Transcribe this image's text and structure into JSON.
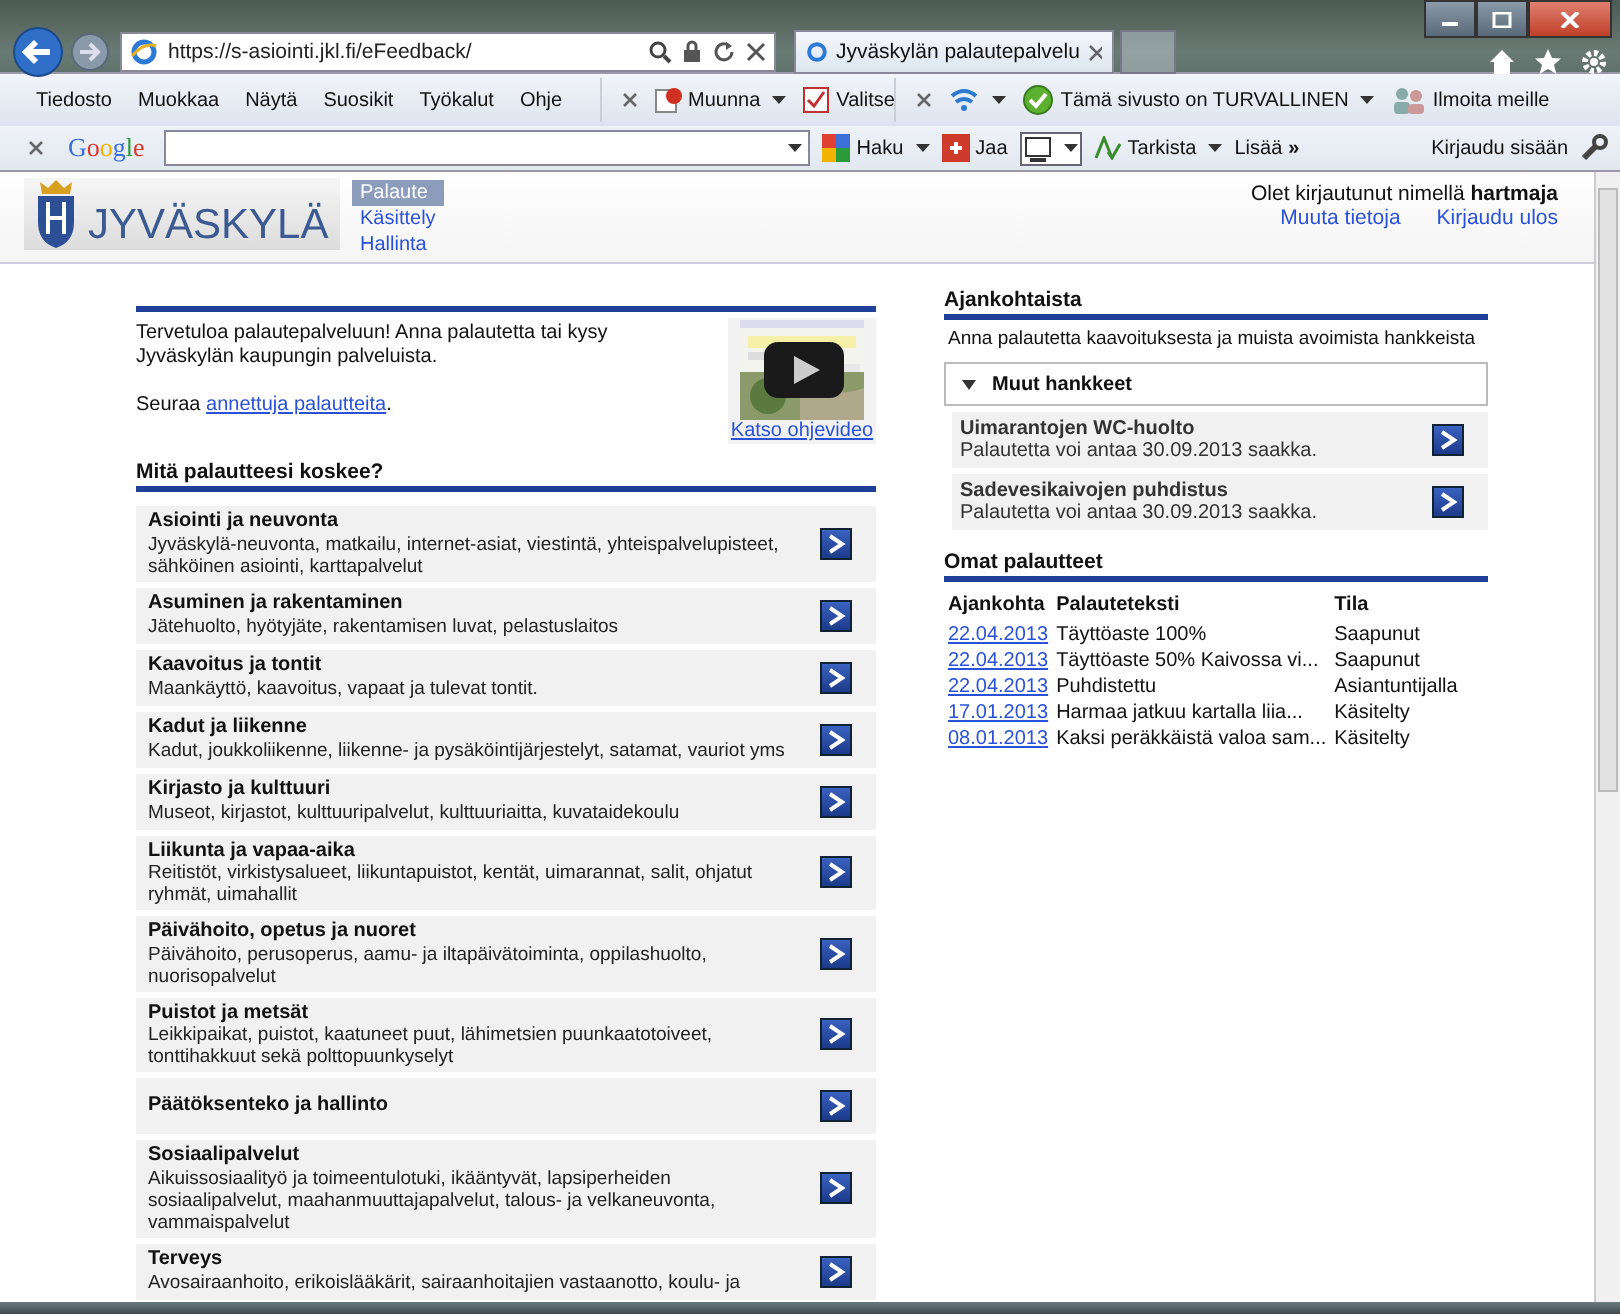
{
  "browser": {
    "address": "https://s-asiointi.jkl.fi/eFeedback/",
    "tab_title": "Jyväskylän palautepalvelu",
    "menu": [
      "Tiedosto",
      "Muokkaa",
      "Näytä",
      "Suosikit",
      "Työkalut",
      "Ohje"
    ],
    "toolbar": [
      {
        "kind": "convert",
        "label": "Muunna"
      },
      {
        "kind": "select",
        "label": "Valitse"
      }
    ],
    "safety": {
      "status": "Tämä sivusto on TURVALLINEN",
      "report": "Ilmoita meille"
    },
    "google": {
      "logo": "Google",
      "search": "Haku",
      "share": "Jaa",
      "check": "Tarkista",
      "more": "Lisää",
      "more_glyph": "»",
      "signin": "Kirjaudu sisään"
    }
  },
  "site": {
    "logo": "JYVÄSKYLÄ",
    "nav": [
      {
        "label": "Palaute",
        "selected": true
      },
      {
        "label": "Käsittely",
        "selected": false
      },
      {
        "label": "Hallinta",
        "selected": false
      }
    ],
    "login": "Olet kirjautunut nimellä **hartmaja**",
    "user_links": [
      "Muuta tietoja",
      "Kirjaudu ulos"
    ]
  },
  "intro": {
    "text": "Tervetuloa palautepalveluun! Anna palautetta tai kysy Jyväskylän kaupungin palveluista.",
    "follow": "Seuraa",
    "follow_link": "annettuja palautteita",
    "follow_end": ".",
    "video_link": "Katso ohjevideo"
  },
  "categories_title": "Mitä palautteesi koskee?",
  "categories": [
    {
      "title": "Asiointi ja neuvonta",
      "description": "Jyväskylä-neuvonta, matkailu, internet-asiat, viestintä, yhteispalvelupisteet, sähköinen asiointi, karttapalvelut"
    },
    {
      "title": "Asuminen ja rakentaminen",
      "description": "Jätehuolto, hyötyjäte, rakentamisen luvat, pelastuslaitos"
    },
    {
      "title": "Kaavoitus ja tontit",
      "description": "Maankäyttö, kaavoitus, vapaat ja tulevat tontit."
    },
    {
      "title": "Kadut ja liikenne",
      "description": "Kadut, joukkoliikenne, liikenne- ja pysäköintijärjestelyt, satamat, vauriot yms"
    },
    {
      "title": "Kirjasto ja kulttuuri",
      "description": "Museot, kirjastot, kulttuuripalvelut, kulttuuriaitta, kuvataidekoulu"
    },
    {
      "title": "Liikunta ja vapaa-aika",
      "description": "Reitistöt, virkistysalueet, liikuntapuistot, kentät, uimarannat, salit, ohjatut ryhmät, uimahallit"
    },
    {
      "title": "Päivähoito, opetus ja nuoret",
      "description": "Päivähoito, perusoperus, aamu- ja iltapäivätoiminta, oppilashuolto, nuorisopalvelut"
    },
    {
      "title": "Puistot ja metsät",
      "description": "Leikkipaikat, puistot, kaatuneet puut, lähimetsien puunkaatotoiveet, tonttihakkuut sekä polttopuunkyselyt"
    },
    {
      "title": "Päätöksenteko ja hallinto"
    },
    {
      "title": "Sosiaalipalvelut",
      "description": "Aikuissosiaalityö ja toimeentulotuki, ikääntyvät, lapsiperheiden sosiaalipalvelut, maahanmuuttajapalvelut, talous- ja velkaneuvonta, vammaispalvelut"
    },
    {
      "title": "Terveys",
      "description": "Avosairaanhoito, erikoislääkärit, sairaanhoitajien vastaanotto, koulu- ja"
    }
  ],
  "news": {
    "title": "Ajankohtaista",
    "intro": "Anna palautetta kaavoituksesta ja muista avoimista hankkeista",
    "group": {
      "label": "Muut hankkeet",
      "expanded": true
    },
    "projects": [
      {
        "title": "Uimarantojen WC-huolto",
        "note": "Palautetta voi antaa 30.09.2013 saakka."
      },
      {
        "title": "Sadevesikaivojen puhdistus",
        "note": "Palautetta voi antaa 30.09.2013 saakka."
      }
    ]
  },
  "own": {
    "title": "Omat palautteet",
    "columns": [
      "Ajankohta",
      "Palauteteksti",
      "Tila"
    ],
    "rows": [
      [
        "22.04.2013",
        "Täyttöaste 100%",
        "Saapunut"
      ],
      [
        "22.04.2013",
        "Täyttöaste 50% Kaivossa vi...",
        "Saapunut"
      ],
      [
        "22.04.2013",
        "Puhdistettu",
        "Asiantuntijalla"
      ],
      [
        "17.01.2013",
        "Harmaa jatkuu kartalla liia...",
        "Käsitelty"
      ],
      [
        "08.01.2013",
        "Kaksi peräkkäistä valoa sam...",
        "Käsitelty"
      ]
    ]
  }
}
